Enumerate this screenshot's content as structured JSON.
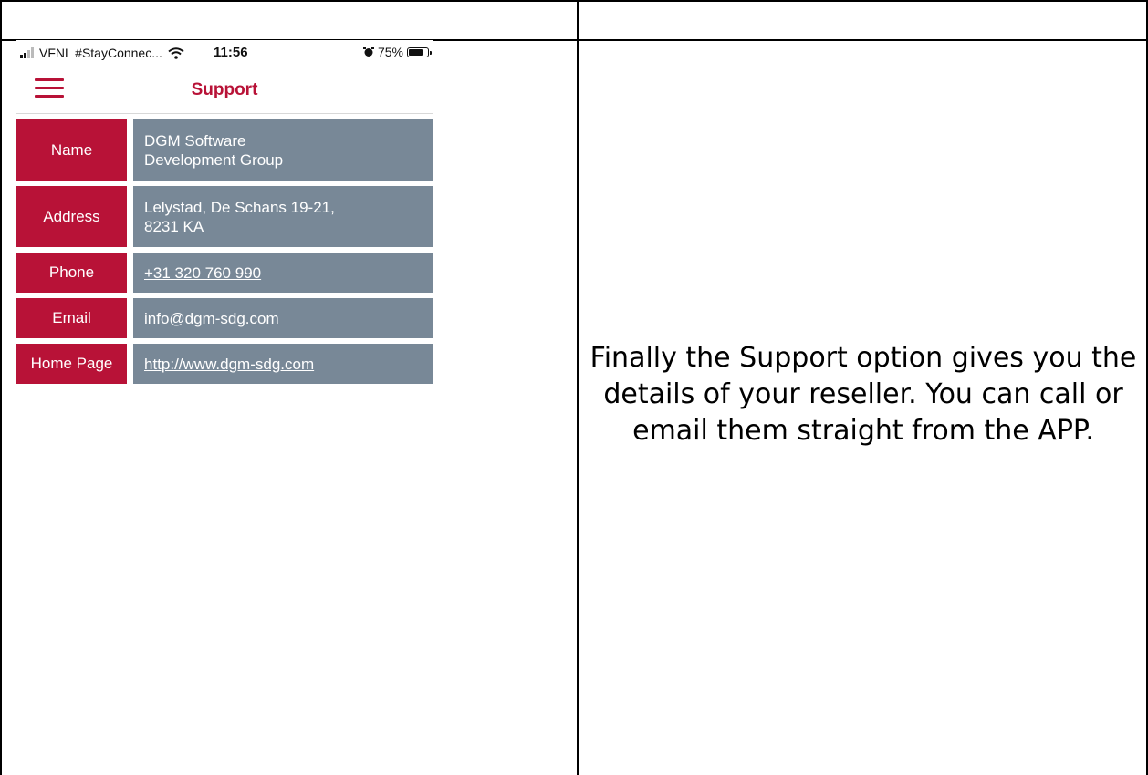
{
  "phone": {
    "status_bar": {
      "carrier": "VFNL #StayConnec...",
      "time": "11:56",
      "battery": "75%",
      "battery_level": 0.75,
      "icons": [
        "signal-icon",
        "wifi-icon",
        "alarm-icon",
        "battery-icon"
      ]
    },
    "header": {
      "title": "Support",
      "menu_icon": "hamburger-menu-icon"
    },
    "rows": [
      {
        "label": "Name",
        "value": "DGM Software\nDevelopment Group",
        "link": false
      },
      {
        "label": "Address",
        "value": "Lelystad, De Schans 19-21,\n8231 KA",
        "link": false
      },
      {
        "label": "Phone",
        "value": "+31 320 760 990",
        "link": true
      },
      {
        "label": "Email",
        "value": "info@dgm-sdg.com",
        "link": true
      },
      {
        "label": "Home Page",
        "value": "http://www.dgm-sdg.com",
        "link": true
      }
    ],
    "colors": {
      "accent": "#b81237",
      "value_bg": "#788897"
    }
  },
  "caption": {
    "text": "Finally the Support option gives you the details of your reseller. You can call or email them straight from the APP."
  }
}
